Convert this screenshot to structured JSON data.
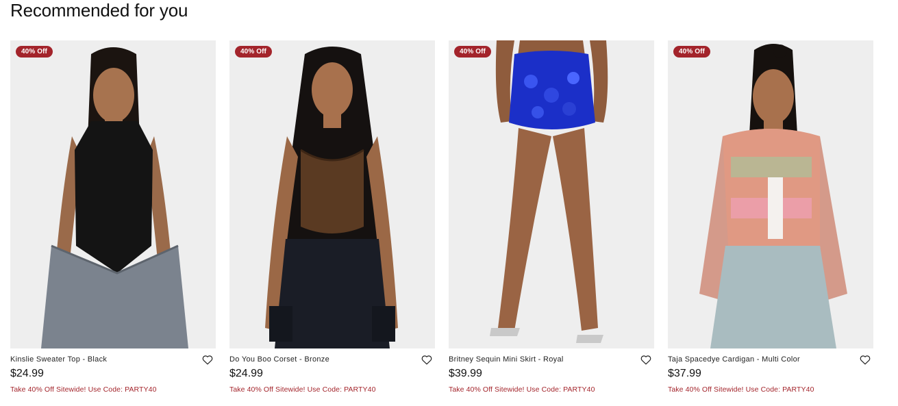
{
  "section": {
    "title": "Recommended for you"
  },
  "products": [
    {
      "name": "Kinslie Sweater Top - Black",
      "price": "$24.99",
      "badge": "40% Off",
      "promo": "Take 40% Off Sitewide! Use Code: PARTY40",
      "image_desc": "model-black-halter-sweater-gray-cargo-jeans"
    },
    {
      "name": "Do You Boo Corset - Bronze",
      "price": "$24.99",
      "badge": "40% Off",
      "promo": "Take 40% Off Sitewide! Use Code: PARTY40",
      "image_desc": "model-bronze-corset-dark-cargo-jeans"
    },
    {
      "name": "Britney Sequin Mini Skirt - Royal",
      "price": "$39.99",
      "badge": "40% Off",
      "promo": "Take 40% Off Sitewide! Use Code: PARTY40",
      "image_desc": "model-royal-blue-sequin-skirt-silver-heels"
    },
    {
      "name": "Taja Spacedye Cardigan - Multi Color",
      "price": "$37.99",
      "badge": "40% Off",
      "promo": "Take 40% Off Sitewide! Use Code: PARTY40",
      "image_desc": "model-multicolor-spacedye-cardigan-light-jeans"
    }
  ],
  "colors": {
    "badge_bg": "#a3242b",
    "promo_text": "#a3242b",
    "image_bg": "#eeeeee"
  },
  "icons": {
    "wishlist": "heart-outline-icon"
  }
}
